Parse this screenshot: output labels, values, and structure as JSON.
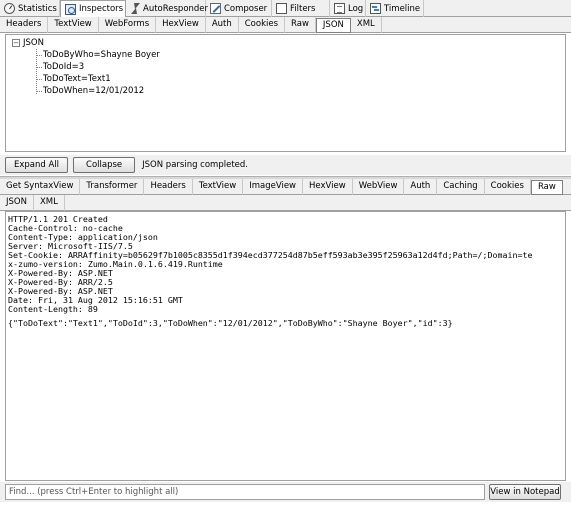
{
  "main_tabs": [
    {
      "label": "Statistics",
      "icon": "statistics-icon",
      "active": false
    },
    {
      "label": "Inspectors",
      "icon": "inspectors-icon",
      "active": true
    },
    {
      "label": "AutoResponder",
      "icon": "autoresponder-icon",
      "active": false
    },
    {
      "label": "Composer",
      "icon": "composer-icon",
      "active": false
    },
    {
      "label": "Filters",
      "icon": "filters-checkbox-icon",
      "active": false
    },
    {
      "label": "Log",
      "icon": "log-icon",
      "active": false
    },
    {
      "label": "Timeline",
      "icon": "timeline-icon",
      "active": false
    }
  ],
  "request_tabs": {
    "row1": [
      "Headers",
      "TextView",
      "WebForms",
      "HexView",
      "Auth",
      "Cookies",
      "Raw",
      "JSON",
      "XML"
    ],
    "selected": "JSON"
  },
  "json_tree": {
    "root": "JSON",
    "expander": "−",
    "items": [
      "ToDoByWho=Shayne Boyer",
      "ToDoId=3",
      "ToDoText=Text1",
      "ToDoWhen=12/01/2012"
    ]
  },
  "actions": {
    "expand_all": "Expand All",
    "collapse": "Collapse",
    "status": "JSON parsing completed."
  },
  "response_tabs": {
    "row1": [
      "Get SyntaxView",
      "Transformer",
      "Headers",
      "TextView",
      "ImageView",
      "HexView",
      "WebView",
      "Auth",
      "Caching",
      "Cookies",
      "Raw"
    ],
    "row2": [
      "JSON",
      "XML"
    ],
    "selected": "Raw"
  },
  "raw_response": {
    "lines": [
      "HTTP/1.1 201 Created",
      "Cache-Control: no-cache",
      "Content-Type: application/json",
      "Server: Microsoft-IIS/7.5",
      "Set-Cookie: ARRAffinity=b05629f7b1005c8355d1f394ecd377254d87b5eff593ab3e395f25963a12d4fd;Path=/;Domain=te",
      "x-zumo-version: Zumo.Main.0.1.6.419.Runtime",
      "X-Powered-By: ASP.NET",
      "X-Powered-By: ARR/2.5",
      "X-Powered-By: ASP.NET",
      "Date: Fri, 31 Aug 2012 15:16:51 GMT",
      "Content-Length: 89"
    ],
    "body": "{\"ToDoText\":\"Text1\",\"ToDoId\":3,\"ToDoWhen\":\"12/01/2012\",\"ToDoByWho\":\"Shayne Boyer\",\"id\":3}"
  },
  "find": {
    "placeholder": "Find... (press Ctrl+Enter to highlight all)",
    "notepad_button": "View in Notepad"
  }
}
